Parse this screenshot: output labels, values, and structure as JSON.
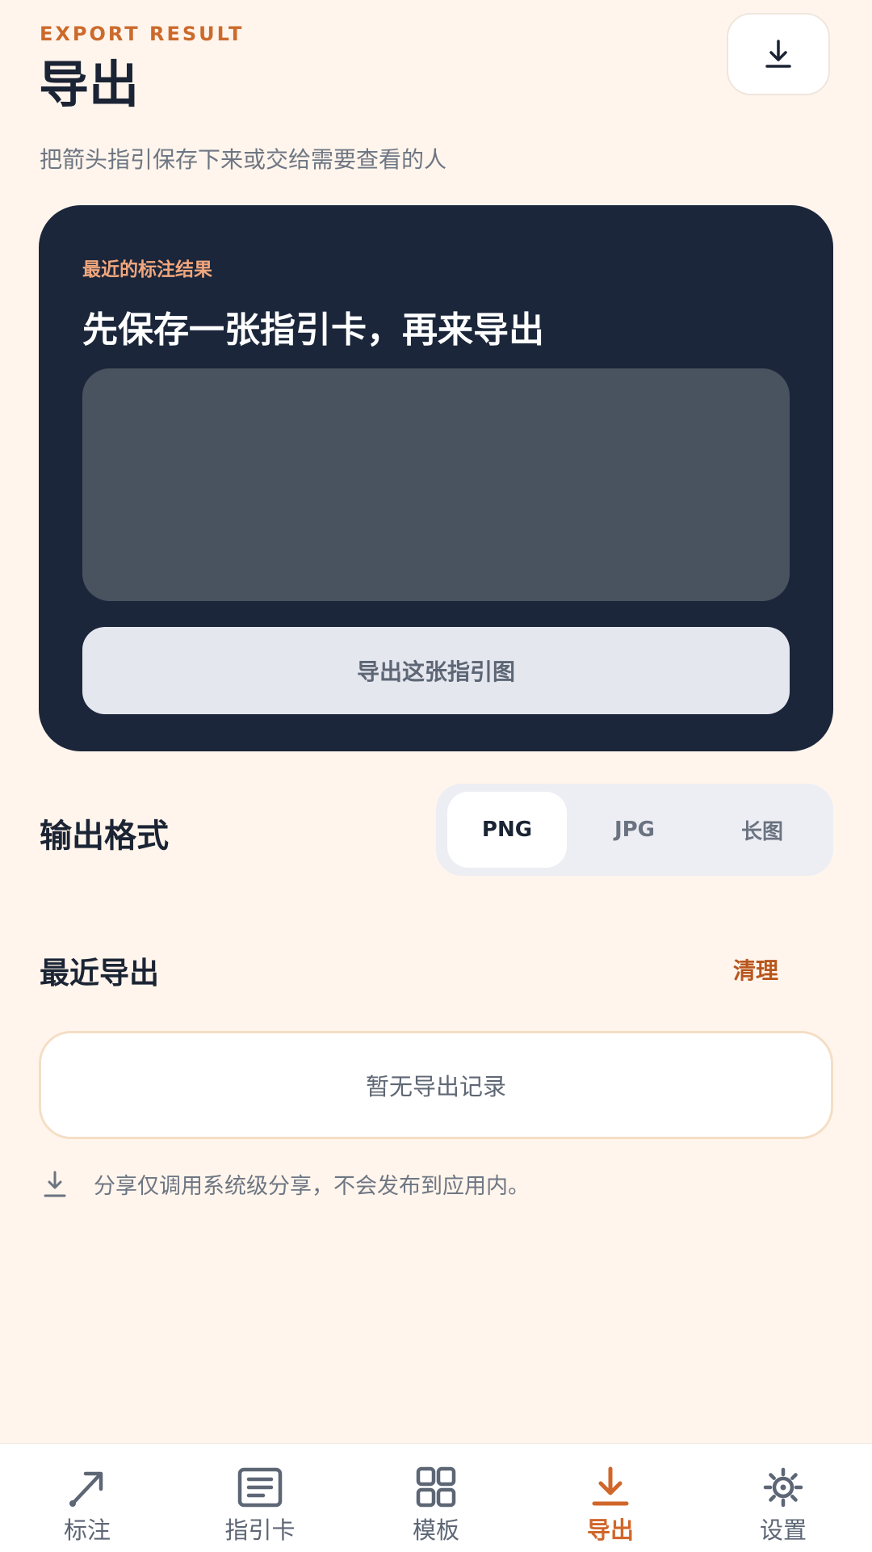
{
  "header": {
    "eyebrow": "EXPORT RESULT",
    "title": "导出",
    "subtitle": "把箭头指引保存下来或交给需要查看的人",
    "download_icon": "download-icon"
  },
  "card": {
    "eyebrow": "最近的标注结果",
    "title": "先保存一张指引卡，再来导出",
    "export_button": "导出这张指引图"
  },
  "format": {
    "label": "输出格式",
    "options": [
      "PNG",
      "JPG",
      "长图"
    ],
    "selected": "PNG"
  },
  "recent": {
    "label": "最近导出",
    "clear": "清理",
    "empty": "暂无导出记录"
  },
  "note": {
    "icon": "download-icon",
    "text": "分享仅调用系统级分享，不会发布到应用内。"
  },
  "nav": {
    "items": [
      {
        "label": "标注",
        "icon": "arrow-icon"
      },
      {
        "label": "指引卡",
        "icon": "card-icon"
      },
      {
        "label": "模板",
        "icon": "grid-icon"
      },
      {
        "label": "导出",
        "icon": "download-icon"
      },
      {
        "label": "设置",
        "icon": "gear-icon"
      }
    ],
    "active": "导出"
  },
  "colors": {
    "background": "#FFF5EC",
    "accent": "#CC6A2C",
    "card": "#1B263A",
    "text": "#1B2434"
  }
}
